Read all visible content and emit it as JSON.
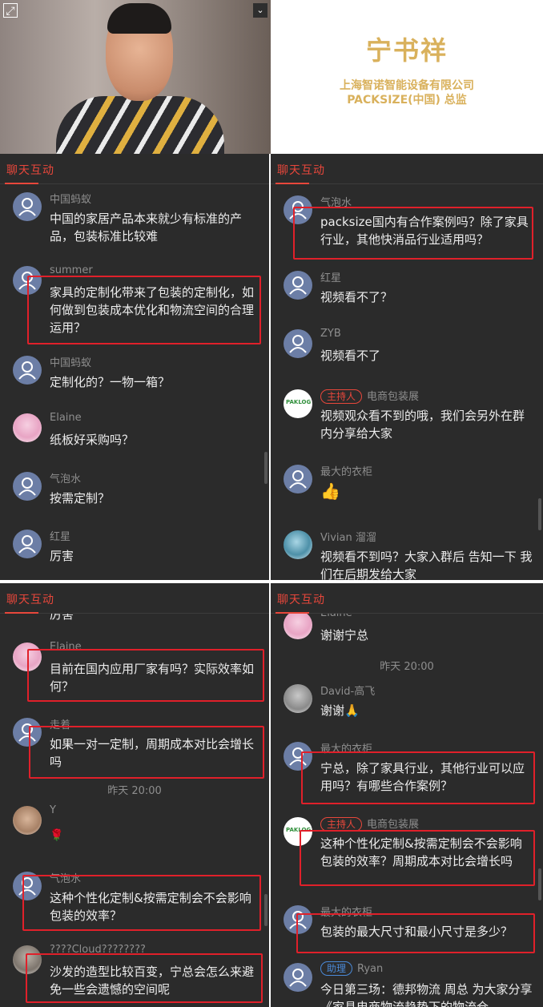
{
  "video": {
    "expand_icon": "expand-icon",
    "collapse_icon": "chevrons-icon"
  },
  "title_card": {
    "name": "宁书祥",
    "company": "上海智诺智能设备有限公司",
    "role": "PACKSIZE(中国) 总监"
  },
  "panel_title": "聊天互动",
  "panel1": {
    "messages": [
      {
        "name": "中国蚂蚁",
        "text": "中国的家居产品本来就少有标准的产品，包装标准比较难"
      },
      {
        "name": "summer",
        "text": "家具的定制化带来了包装的定制化，如何做到包装成本优化和物流空间的合理运用？"
      },
      {
        "name": "中国蚂蚁",
        "text": "定制化的？一物一箱？"
      },
      {
        "name": "Elaine",
        "text": "纸板好采购吗？"
      },
      {
        "name": "气泡水",
        "text": "按需定制？"
      },
      {
        "name": "红星",
        "text": "厉害"
      }
    ]
  },
  "panel2": {
    "messages": [
      {
        "name": "气泡水",
        "text": "packsize国内有合作案例吗？除了家具行业，其他快消品行业适用吗？"
      },
      {
        "name": "红星",
        "text": "视频看不了？"
      },
      {
        "name": "ZYB",
        "text": "视频看不了"
      },
      {
        "badge": "主持人",
        "name": "电商包装展",
        "text": "视频观众看不到的哦，我们会另外在群内分享给大家",
        "logo": "PAKLOG"
      },
      {
        "name": "最大的衣柜",
        "text": "👍"
      },
      {
        "name": "Vivian 溜溜",
        "text": "视频看不到吗？大家入群后 告知一下 我们在后期发给大家"
      }
    ]
  },
  "panel3": {
    "prev_text": "厉害",
    "time": "昨天 20:00",
    "messages": [
      {
        "name": "Elaine",
        "text": "目前在国内应用厂家有吗？实际效率如何？"
      },
      {
        "name": "走着",
        "text": "如果一对一定制，周期成本对比会增长吗"
      },
      {
        "name": "Y",
        "text": "🌹"
      },
      {
        "name": "气泡水",
        "text": "这种个性化定制&按需定制会不会影响包装的效率？"
      },
      {
        "name": "????Cloud????????",
        "text": "沙发的造型比较百变，宁总会怎么来避免一些会遗憾的空间呢"
      }
    ]
  },
  "panel4": {
    "time": "昨天 20:00",
    "messages": [
      {
        "name": "Elaine",
        "text": "谢谢宁总"
      },
      {
        "name": "David-高飞",
        "text": "谢谢🙏"
      },
      {
        "name": "最大的衣柜",
        "text": "宁总，除了家具行业，其他行业可以应用吗？有哪些合作案例？"
      },
      {
        "badge": "主持人",
        "name": "电商包装展",
        "text": "这种个性化定制&按需定制会不会影响包装的效率？周期成本对比会增长吗",
        "logo": "PAKLOG"
      },
      {
        "name": "最大的衣柜",
        "text": "包装的最大尺寸和最小尺寸是多少？"
      },
      {
        "badge": "助理",
        "name": "Ryan",
        "text": "今日第三场：德邦物流 周总 为大家分享《家具电商物流趋势下的物流仓…"
      }
    ]
  }
}
